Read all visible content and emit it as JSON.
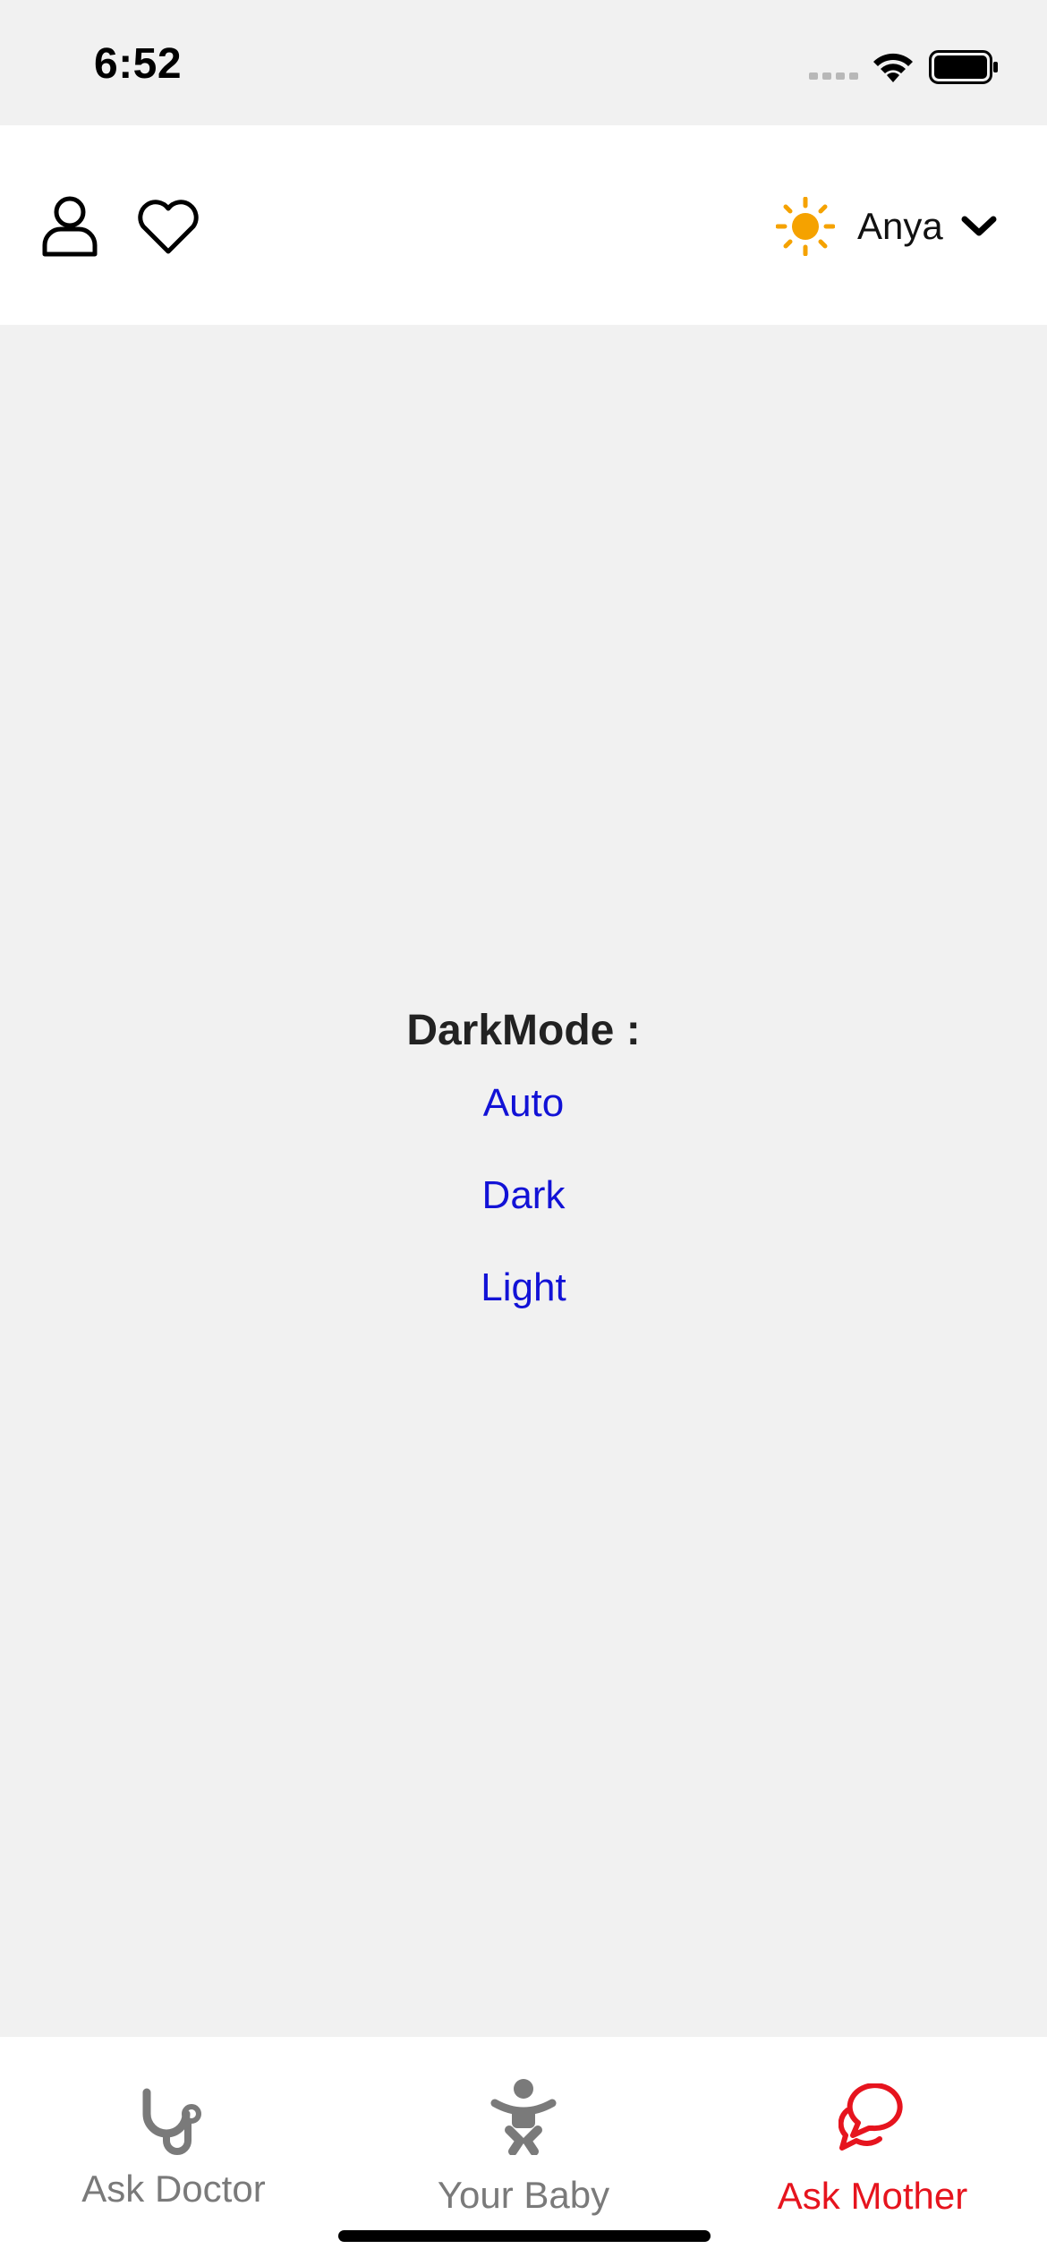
{
  "status_bar": {
    "time": "6:52"
  },
  "header": {
    "user_name": "Anya",
    "icons": {
      "profile": "person-outline-icon",
      "favorites": "heart-outline-icon",
      "theme": "sun-icon",
      "menu": "chevron-down-icon"
    }
  },
  "main": {
    "title": "DarkMode :",
    "options": [
      {
        "label": "Auto"
      },
      {
        "label": "Dark"
      },
      {
        "label": "Light"
      }
    ]
  },
  "tab_bar": {
    "tabs": [
      {
        "label": "Ask Doctor",
        "icon": "stethoscope-icon",
        "active": false
      },
      {
        "label": "Your Baby",
        "icon": "baby-icon",
        "active": false
      },
      {
        "label": "Ask Mother",
        "icon": "chat-bubbles-icon",
        "active": true
      }
    ]
  },
  "colors": {
    "background": "#f1f1f1",
    "surface": "#ffffff",
    "link": "#1212d6",
    "active_tab": "#e6141e",
    "inactive_tab": "#7a7a7a",
    "sun": "#f5a200"
  }
}
